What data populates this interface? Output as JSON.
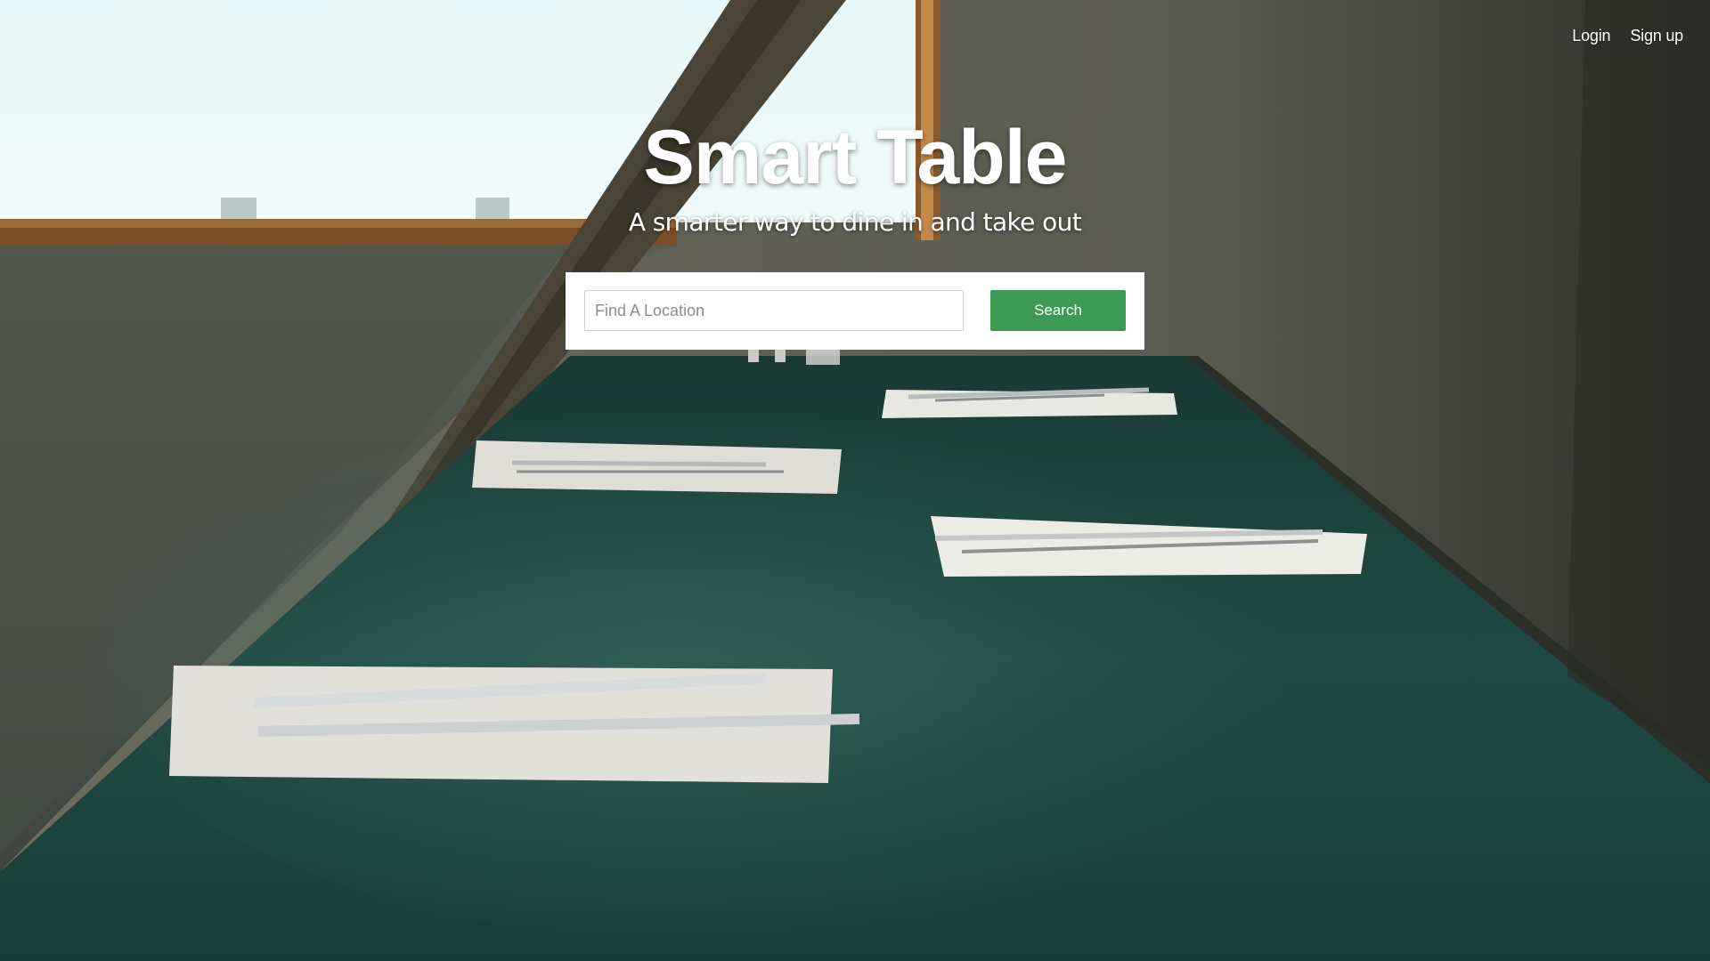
{
  "nav": {
    "login_label": "Login",
    "signup_label": "Sign up"
  },
  "hero": {
    "title": "Smart Table",
    "subtitle": "A smarter way to dine in and take out",
    "background_description_icon": "restaurant-table-photo"
  },
  "search": {
    "placeholder": "Find A Location",
    "value": "",
    "button_label": "Search"
  },
  "colors": {
    "accent": "#3d9a56",
    "text_light": "#ffffff"
  }
}
